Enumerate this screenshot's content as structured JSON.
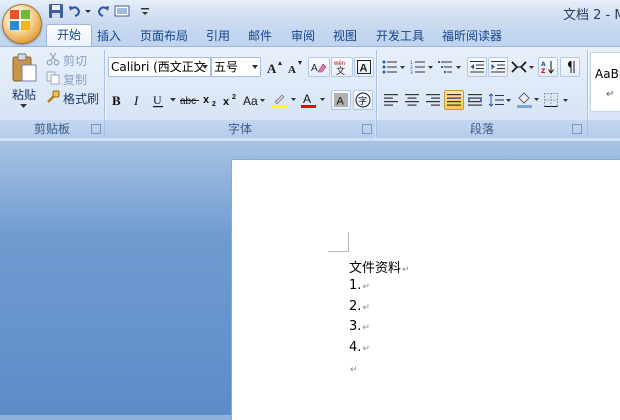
{
  "window": {
    "title": "文档 2 - M"
  },
  "tabs": [
    "开始",
    "插入",
    "页面布局",
    "引用",
    "邮件",
    "审阅",
    "视图",
    "开发工具",
    "福昕阅读器"
  ],
  "clipboard": {
    "paste_label": "粘贴",
    "cut_label": "剪切",
    "copy_label": "复制",
    "format_painter_label": "格式刷",
    "group_label": "剪贴板"
  },
  "font": {
    "font_name": "Calibri (西文正文",
    "font_size": "五号",
    "group_label": "字体"
  },
  "paragraph": {
    "group_label": "段落"
  },
  "styles": {
    "preview_text": "AaBl",
    "preview_mark": "↵"
  },
  "document": {
    "lines": [
      "文件资料",
      "1.",
      "2.",
      "3.",
      "4.",
      ""
    ],
    "paragraph_mark": "↵"
  },
  "colors": {
    "tab_text": "#15428b",
    "ribbon_bg": "#dbe7f6",
    "highlight_yellow": "#ffff00",
    "font_color_red": "#ff0000",
    "workspace_blue": "#6f9bd0"
  }
}
